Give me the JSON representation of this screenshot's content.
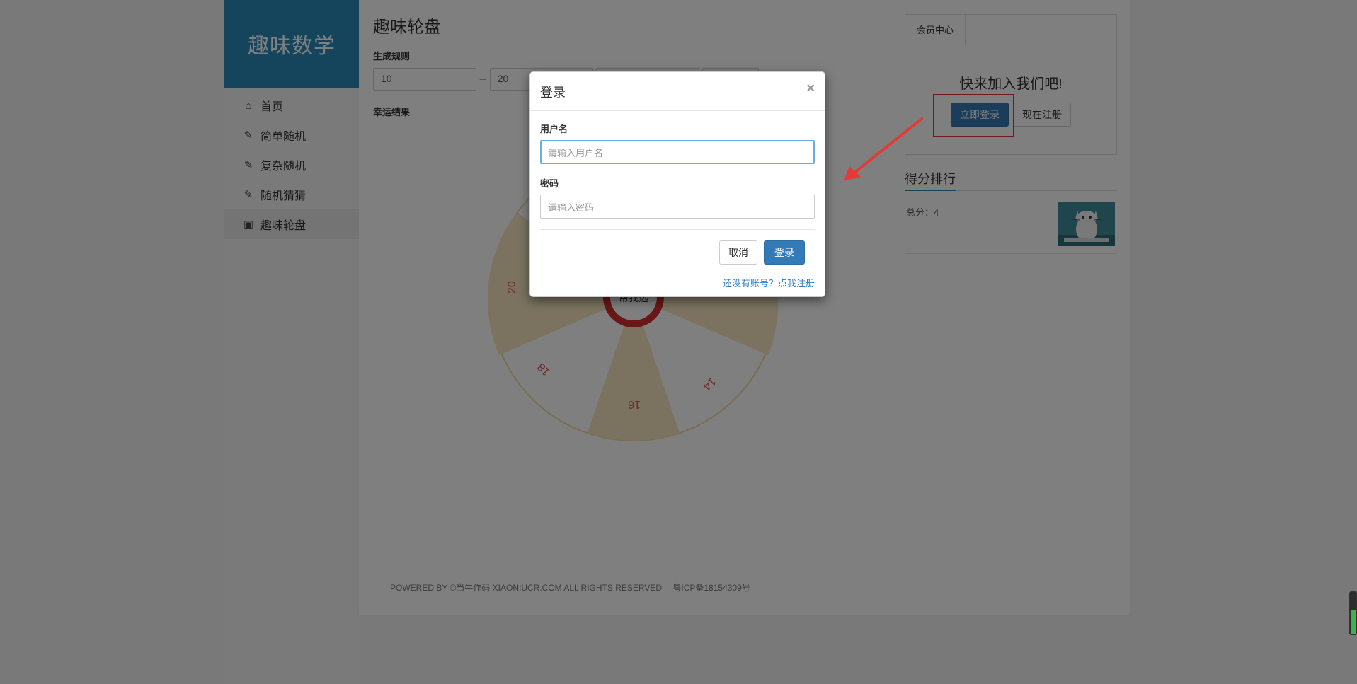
{
  "sidebar": {
    "logo": "趣味数学",
    "items": [
      {
        "label": "首页",
        "icon": "home-icon"
      },
      {
        "label": "简单随机",
        "icon": "eraser-icon"
      },
      {
        "label": "复杂随机",
        "icon": "eraser-icon"
      },
      {
        "label": "随机猜猜",
        "icon": "eraser-icon"
      },
      {
        "label": "趣味轮盘",
        "icon": "inbox-icon",
        "active": true
      }
    ]
  },
  "main": {
    "title": "趣味轮盘",
    "rule_label": "生成规则",
    "min_value": "10",
    "dash": "--",
    "max_value": "20",
    "result_label": "幸运结果",
    "wheel": {
      "numbers": [
        "20",
        "18",
        "16",
        "14"
      ],
      "center_text": "帮我选"
    }
  },
  "member": {
    "tab": "会员中心",
    "join_text": "快来加入我们吧!",
    "login_button": "立即登录",
    "register_button": "现在注册"
  },
  "score": {
    "title": "得分排行",
    "total": "总分：4"
  },
  "footer": {
    "text": "POWERED BY ©当牛作码 XIAONIUCR.COM ALL RIGHTS RESERVED",
    "icp": "粤ICP备18154309号"
  },
  "modal": {
    "title": "登录",
    "close": "×",
    "username_label": "用户名",
    "username_placeholder": "请输入用户名",
    "password_label": "密码",
    "password_placeholder": "请输入密码",
    "cancel_button": "取消",
    "login_button": "登录",
    "register_link": "还没有账号？点我注册"
  },
  "colors": {
    "brand": "#2a8ab8",
    "primary_button": "#337ab7",
    "wheel_segment": "#f6e6c0",
    "wheel_text": "#e05050",
    "annotation_red": "#e53935"
  }
}
